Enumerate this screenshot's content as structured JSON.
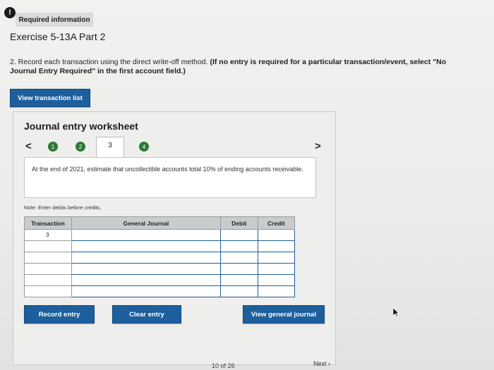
{
  "alert_icon": "!",
  "required_tab": "Required information",
  "exercise_title": "Exercise 5-13A Part 2",
  "instructions": {
    "plain": "2. Record each transaction using the direct write-off method.",
    "bold": " (If no entry is required for a particular transaction/event, select \"No Journal Entry Required\" in the first account field.)"
  },
  "view_transaction_list": "View transaction list",
  "worksheet": {
    "title": "Journal entry worksheet",
    "prev_icon": "<",
    "next_icon": ">",
    "steps": [
      "1",
      "2",
      "3",
      "4"
    ],
    "active_step": "3",
    "description": "At the end of 2021, estimate that uncollectible accounts total 10% of ending accounts receivable.",
    "note": "Note: Enter debits before credits."
  },
  "journal_table": {
    "headers": [
      "Transaction",
      "General Journal",
      "Debit",
      "Credit"
    ],
    "rows": [
      {
        "transaction": "3",
        "account": "",
        "debit": "",
        "credit": ""
      },
      {
        "transaction": "",
        "account": "",
        "debit": "",
        "credit": ""
      },
      {
        "transaction": "",
        "account": "",
        "debit": "",
        "credit": ""
      },
      {
        "transaction": "",
        "account": "",
        "debit": "",
        "credit": ""
      },
      {
        "transaction": "",
        "account": "",
        "debit": "",
        "credit": ""
      },
      {
        "transaction": "",
        "account": "",
        "debit": "",
        "credit": ""
      }
    ]
  },
  "buttons": {
    "record_entry": "Record entry",
    "clear_entry": "Clear entry",
    "view_general_journal": "View general journal"
  },
  "footer": {
    "page_info": "10 of 26",
    "next": "Next"
  },
  "colors": {
    "button_blue": "#1d5f9c",
    "step_green": "#2c7a32",
    "header_gray": "#c9ccce"
  }
}
